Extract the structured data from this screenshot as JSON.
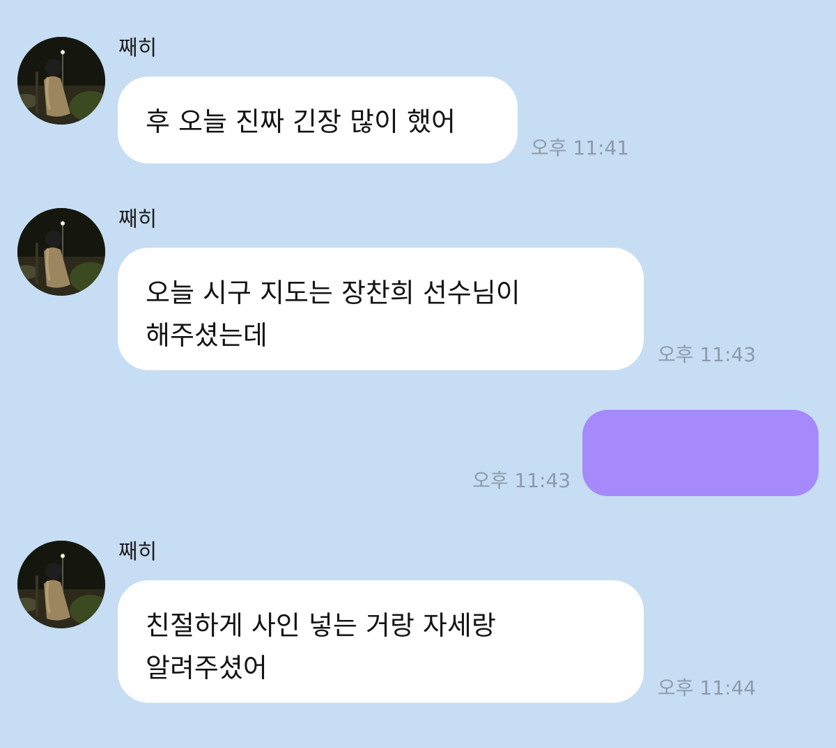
{
  "chat": {
    "messages": [
      {
        "sender": "째히",
        "text": "후 오늘 진짜 긴장 많이 했어",
        "time": "오후 11:41",
        "direction": "incoming"
      },
      {
        "sender": "째히",
        "lines": [
          "오늘 시구 지도는 장찬희 선수님이",
          "해주셨는데"
        ],
        "time": "오후 11:43",
        "direction": "incoming"
      },
      {
        "text": "",
        "time": "오후 11:43",
        "direction": "outgoing"
      },
      {
        "sender": "째히",
        "lines": [
          "친절하게 사인 넣는 거랑 자세랑",
          "알려주셨어"
        ],
        "time": "오후 11:44",
        "direction": "incoming"
      }
    ]
  },
  "colors": {
    "background": "#c7ddf3",
    "incoming_bubble": "#ffffff",
    "outgoing_bubble": "#a689fa",
    "timestamp": "#8c9aab"
  }
}
